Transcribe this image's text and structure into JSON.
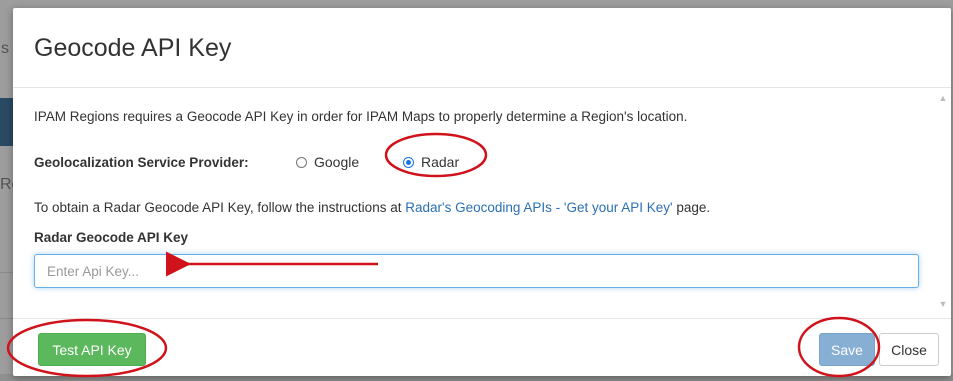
{
  "background": {
    "fragment_left_1": "s",
    "fragment_left_2": "Re"
  },
  "modal": {
    "title": "Geocode API Key",
    "intro_text": "IPAM Regions requires a Geocode API Key in order for IPAM Maps to properly determine a Region's location.",
    "provider_label": "Geolocalization Service Provider:",
    "providers": [
      {
        "label": "Google",
        "selected": false
      },
      {
        "label": "Radar",
        "selected": true
      }
    ],
    "instructions_prefix": "To obtain a Radar Geocode API Key, follow the instructions at ",
    "instructions_link": "Radar's Geocoding APIs - 'Get your API Key'",
    "instructions_suffix": " page.",
    "api_key_label": "Radar Geocode API Key",
    "api_key_value": "",
    "api_key_placeholder": "Enter Api Key...",
    "footer": {
      "test_label": "Test API Key",
      "save_label": "Save",
      "close_label": "Close"
    }
  },
  "colors": {
    "annotation": "#d0121b",
    "primary_disabled": "#87aed3",
    "success": "#5cb85c",
    "link": "#2a6fb4"
  }
}
